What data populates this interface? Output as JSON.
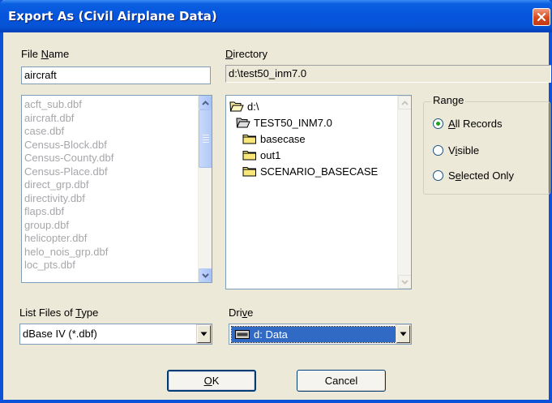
{
  "window": {
    "title": "Export As (Civil Airplane Data)"
  },
  "file_name": {
    "label_pre": "File ",
    "label_u": "N",
    "label_post": "ame",
    "value": "aircraft"
  },
  "directory": {
    "label_u": "D",
    "label_post": "irectory",
    "value": "d:\\test50_inm7.0"
  },
  "files": [
    "acft_sub.dbf",
    "aircraft.dbf",
    "case.dbf",
    "Census-Block.dbf",
    "Census-County.dbf",
    "Census-Place.dbf",
    "direct_grp.dbf",
    "directivity.dbf",
    "flaps.dbf",
    "group.dbf",
    "helicopter.dbf",
    "helo_nois_grp.dbf",
    "loc_pts.dbf"
  ],
  "dir_tree": [
    {
      "label": "d:\\",
      "icon": "open-folder-icon"
    },
    {
      "label": "TEST50_INM7.0",
      "icon": "open-folder-icon"
    },
    {
      "label": "basecase",
      "icon": "folder-icon"
    },
    {
      "label": "out1",
      "icon": "folder-icon"
    },
    {
      "label": "SCENARIO_BASECASE",
      "icon": "folder-icon"
    }
  ],
  "range": {
    "title": "Range",
    "options": [
      {
        "u": "A",
        "rest": "ll Records",
        "pre": "",
        "checked": true
      },
      {
        "pre": "V",
        "u": "i",
        "rest": "sible",
        "checked": false
      },
      {
        "pre": "S",
        "u": "e",
        "rest": "lected Only",
        "checked": false
      }
    ]
  },
  "file_type": {
    "label_pre": "List Files of ",
    "label_u": "T",
    "label_post": "ype",
    "value": "dBase IV (*.dbf)"
  },
  "drive": {
    "label_pre": "Dri",
    "label_u": "v",
    "label_post": "e",
    "value": "d: Data"
  },
  "buttons": {
    "ok_u": "O",
    "ok_rest": "K",
    "cancel": "Cancel"
  },
  "colors": {
    "titlebar": "#0654dc",
    "face": "#ece9d8",
    "selection": "#316ac5",
    "close": "#d8471c"
  }
}
